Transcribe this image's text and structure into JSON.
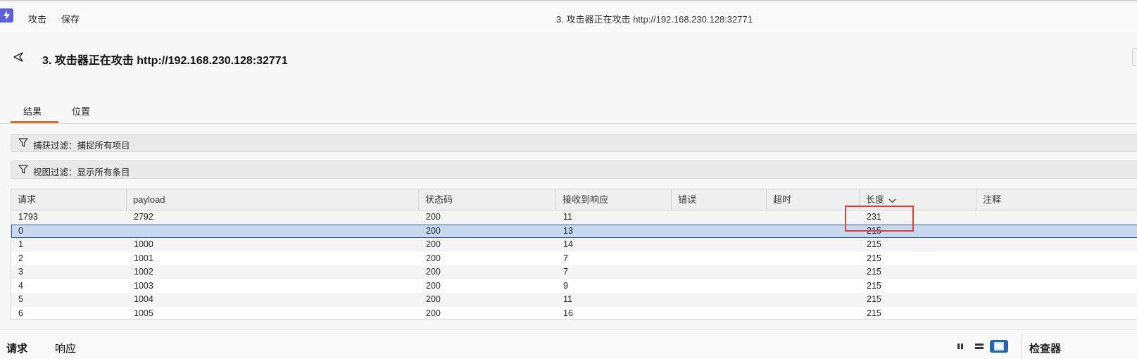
{
  "menu": {
    "attack": "攻击",
    "save": "保存"
  },
  "window_title": "3. 攻击器正在攻击 http://192.168.230.128:32771",
  "page_title": "3. 攻击器正在攻击 http://192.168.230.128:32771",
  "tabs": [
    {
      "label": "结果",
      "active": true
    },
    {
      "label": "位置",
      "active": false
    }
  ],
  "filters": {
    "capture": "捕获过滤：捕捉所有项目",
    "view": "视图过滤：显示所有条目"
  },
  "table": {
    "columns": [
      "请求",
      "payload",
      "状态码",
      "接收到响应",
      "错误",
      "超时",
      "长度",
      "注释"
    ],
    "sorted_column": "长度",
    "rows": [
      [
        "1793",
        "2792",
        "200",
        "11",
        "",
        "",
        "231",
        ""
      ],
      [
        "0",
        "",
        "200",
        "13",
        "",
        "",
        "215",
        ""
      ],
      [
        "1",
        "1000",
        "200",
        "14",
        "",
        "",
        "215",
        ""
      ],
      [
        "2",
        "1001",
        "200",
        "7",
        "",
        "",
        "215",
        ""
      ],
      [
        "3",
        "1002",
        "200",
        "7",
        "",
        "",
        "215",
        ""
      ],
      [
        "4",
        "1003",
        "200",
        "9",
        "",
        "",
        "215",
        ""
      ],
      [
        "5",
        "1004",
        "200",
        "11",
        "",
        "",
        "215",
        ""
      ],
      [
        "6",
        "1005",
        "200",
        "16",
        "",
        "",
        "215",
        ""
      ]
    ],
    "selected_row_index": 1
  },
  "bottom": {
    "request_tab": "请求",
    "response_tab": "响应",
    "inspector": "检查器"
  },
  "colors": {
    "accent": "#e8642c",
    "selection": "#c8d8ee",
    "highlight": "#e8393a",
    "app_icon": "#5b5fdb"
  }
}
